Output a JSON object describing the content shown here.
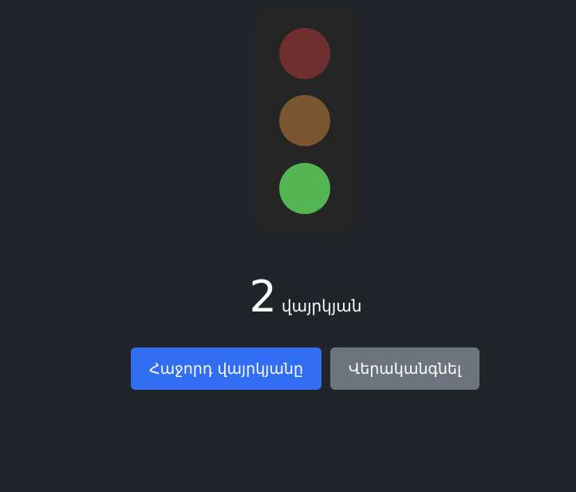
{
  "traffic_light": {
    "lights": [
      {
        "name": "red",
        "color": "#6f2f2f",
        "active": false
      },
      {
        "name": "yellow",
        "color": "#7a5630",
        "active": false
      },
      {
        "name": "green",
        "color": "#53b652",
        "active": true
      }
    ]
  },
  "countdown": {
    "value": "2",
    "unit": "վայրկյան"
  },
  "buttons": {
    "next_label": "Հաջորդ վայրկյանը",
    "next_color": "#316ef2",
    "reset_label": "Վերականգնել",
    "reset_color": "#6c757d"
  }
}
